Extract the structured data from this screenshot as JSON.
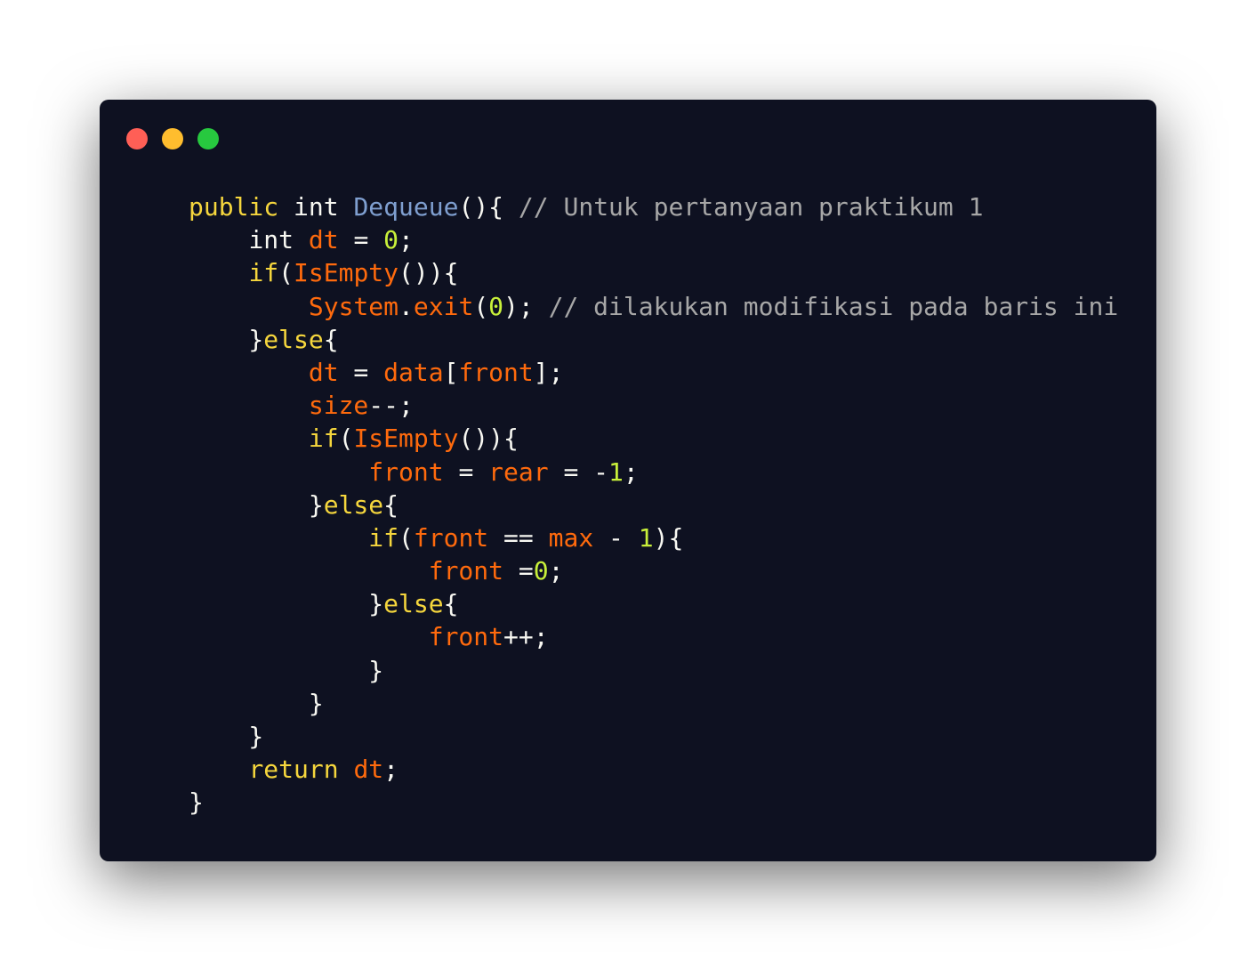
{
  "window": {
    "controls": [
      "close",
      "minimize",
      "maximize"
    ],
    "colors": {
      "background": "#0e1121",
      "close": "#ff5f56",
      "minimize": "#ffbd2e",
      "maximize": "#27c93f"
    }
  },
  "code": {
    "lines": [
      [
        [
          "kw",
          "public"
        ],
        [
          "pun",
          " "
        ],
        [
          "type",
          "int"
        ],
        [
          "pun",
          " "
        ],
        [
          "fn",
          "Dequeue"
        ],
        [
          "pun",
          "(){ "
        ],
        [
          "com",
          "// Untuk pertanyaan praktikum 1"
        ]
      ],
      [
        [
          "pun",
          "    "
        ],
        [
          "type",
          "int"
        ],
        [
          "pun",
          " "
        ],
        [
          "id",
          "dt"
        ],
        [
          "pun",
          " = "
        ],
        [
          "num",
          "0"
        ],
        [
          "pun",
          ";"
        ]
      ],
      [
        [
          "pun",
          "    "
        ],
        [
          "kw",
          "if"
        ],
        [
          "pun",
          "("
        ],
        [
          "id",
          "IsEmpty"
        ],
        [
          "pun",
          "()){"
        ]
      ],
      [
        [
          "pun",
          "        "
        ],
        [
          "id",
          "System"
        ],
        [
          "pun",
          "."
        ],
        [
          "id",
          "exit"
        ],
        [
          "pun",
          "("
        ],
        [
          "num",
          "0"
        ],
        [
          "pun",
          "); "
        ],
        [
          "com",
          "// dilakukan modifikasi pada baris ini"
        ]
      ],
      [
        [
          "pun",
          "    }"
        ],
        [
          "kw",
          "else"
        ],
        [
          "pun",
          "{"
        ]
      ],
      [
        [
          "pun",
          "        "
        ],
        [
          "id",
          "dt"
        ],
        [
          "pun",
          " = "
        ],
        [
          "id",
          "data"
        ],
        [
          "pun",
          "["
        ],
        [
          "id",
          "front"
        ],
        [
          "pun",
          "];"
        ]
      ],
      [
        [
          "pun",
          "        "
        ],
        [
          "id",
          "size"
        ],
        [
          "pun",
          "--;"
        ]
      ],
      [
        [
          "pun",
          "        "
        ],
        [
          "kw",
          "if"
        ],
        [
          "pun",
          "("
        ],
        [
          "id",
          "IsEmpty"
        ],
        [
          "pun",
          "()){"
        ]
      ],
      [
        [
          "pun",
          "            "
        ],
        [
          "id",
          "front"
        ],
        [
          "pun",
          " = "
        ],
        [
          "id",
          "rear"
        ],
        [
          "pun",
          " = -"
        ],
        [
          "num",
          "1"
        ],
        [
          "pun",
          ";"
        ]
      ],
      [
        [
          "pun",
          "        }"
        ],
        [
          "kw",
          "else"
        ],
        [
          "pun",
          "{"
        ]
      ],
      [
        [
          "pun",
          "            "
        ],
        [
          "kw",
          "if"
        ],
        [
          "pun",
          "("
        ],
        [
          "id",
          "front"
        ],
        [
          "pun",
          " == "
        ],
        [
          "id",
          "max"
        ],
        [
          "pun",
          " - "
        ],
        [
          "num",
          "1"
        ],
        [
          "pun",
          "){"
        ]
      ],
      [
        [
          "pun",
          "                "
        ],
        [
          "id",
          "front"
        ],
        [
          "pun",
          " ="
        ],
        [
          "num",
          "0"
        ],
        [
          "pun",
          ";"
        ]
      ],
      [
        [
          "pun",
          "            }"
        ],
        [
          "kw",
          "else"
        ],
        [
          "pun",
          "{"
        ]
      ],
      [
        [
          "pun",
          "                "
        ],
        [
          "id",
          "front"
        ],
        [
          "pun",
          "++;"
        ]
      ],
      [
        [
          "pun",
          "            }"
        ]
      ],
      [
        [
          "pun",
          "        }"
        ]
      ],
      [
        [
          "pun",
          "    }"
        ]
      ],
      [
        [
          "pun",
          "    "
        ],
        [
          "kw",
          "return"
        ],
        [
          "pun",
          " "
        ],
        [
          "id",
          "dt"
        ],
        [
          "pun",
          ";"
        ]
      ],
      [
        [
          "pun",
          "}"
        ]
      ]
    ]
  }
}
